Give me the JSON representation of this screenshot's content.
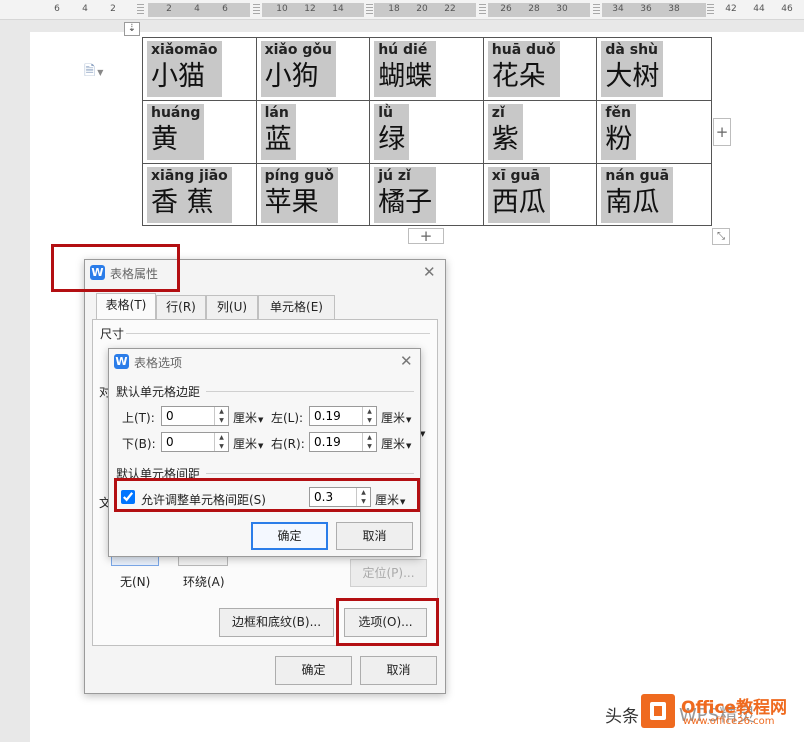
{
  "ruler": {
    "ticks": [
      "6",
      "4",
      "2",
      "2",
      "4",
      "6",
      "10",
      "12",
      "14",
      "18",
      "20",
      "22",
      "26",
      "28",
      "30",
      "34",
      "36",
      "38",
      "42",
      "44",
      "46"
    ]
  },
  "table": {
    "rows": [
      [
        {
          "py": "xiǎomāo",
          "hz": "小猫"
        },
        {
          "py": "xiǎo gǒu",
          "hz": "小狗"
        },
        {
          "py": "hú  dié",
          "hz": "蝴蝶"
        },
        {
          "py": "huā duǒ",
          "hz": "花朵"
        },
        {
          "py": "dà  shù",
          "hz": "大树"
        }
      ],
      [
        {
          "py": "huáng",
          "hz": "黄"
        },
        {
          "py": "lán",
          "hz": "蓝"
        },
        {
          "py": "lǜ",
          "hz": "绿"
        },
        {
          "py": "zǐ",
          "hz": "紫"
        },
        {
          "py": "fěn",
          "hz": "粉"
        }
      ],
      [
        {
          "py": "xiāng jiāo",
          "hz": "香 蕉"
        },
        {
          "py": "píng guǒ",
          "hz": "苹果"
        },
        {
          "py": "jú  zǐ",
          "hz": "橘子"
        },
        {
          "py": "xī  guā",
          "hz": "西瓜"
        },
        {
          "py": "nán guā",
          "hz": "南瓜"
        }
      ]
    ],
    "add_symbol": "+"
  },
  "table_properties": {
    "title": "表格属性",
    "tabs": [
      "表格(T)",
      "行(R)",
      "列(U)",
      "单元格(E)"
    ],
    "size_label": "尺寸",
    "align_label_partial": "对",
    "wrap_label_partial": "文",
    "wrap_none": "无(N)",
    "wrap_around": "环绕(A)",
    "position_button": "定位(P)...",
    "borders_button": "边框和底纹(B)...",
    "options_button": "选项(O)...",
    "ok": "确定",
    "cancel": "取消"
  },
  "table_options": {
    "title": "表格选项",
    "margins_group": "默认单元格边距",
    "top_label": "上(T):",
    "top_value": "0",
    "bottom_label": "下(B):",
    "bottom_value": "0",
    "left_label": "左(L):",
    "left_value": "0.19",
    "right_label": "右(R):",
    "right_value": "0.19",
    "unit": "厘米",
    "spacing_group": "默认单元格间距",
    "allow_spacing_label": "允许调整单元格间距(S)",
    "allow_spacing_checked": true,
    "spacing_value": "0.3",
    "ok": "确定",
    "cancel": "取消"
  },
  "watermark": {
    "left": "头条",
    "brand": "Office教程网",
    "url": "www.office26.com",
    "right": "WPS精灵"
  },
  "colors": {
    "highlight_red": "#b30f12",
    "accent_blue": "#2b7de9",
    "logo_orange": "#ef6a1f"
  }
}
